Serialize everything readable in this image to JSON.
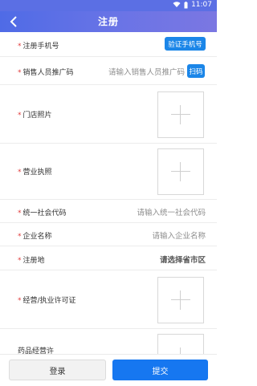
{
  "status": {
    "time": "11:07"
  },
  "header": {
    "title": "注册"
  },
  "form": {
    "phone": {
      "label": "注册手机号",
      "button": "验证手机号"
    },
    "promo": {
      "label": "销售人员推广码",
      "placeholder": "请输入销售人员推广码",
      "scan": "扫码"
    },
    "store_photo": {
      "label": "门店照片"
    },
    "license": {
      "label": "营业执照"
    },
    "credit_code": {
      "label": "统一社会代码",
      "placeholder": "请输入统一社会代码"
    },
    "company": {
      "label": "企业名称",
      "placeholder": "请输入企业名称"
    },
    "address": {
      "label": "注册地",
      "value": "请选择省市区"
    },
    "permit": {
      "label": "经营/执业许可证"
    },
    "next_item": {
      "label": "药品经营许"
    }
  },
  "footer": {
    "login": "登录",
    "submit": "提交"
  }
}
